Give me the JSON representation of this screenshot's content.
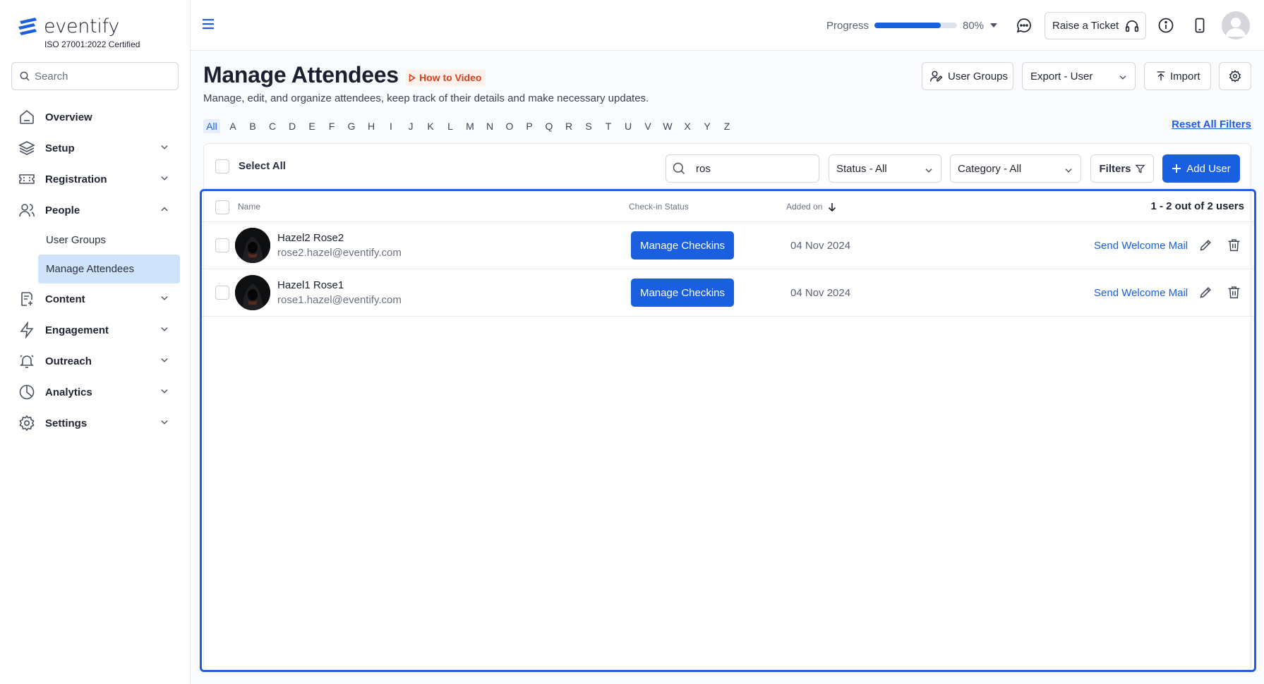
{
  "brand": {
    "name": "eventify",
    "cert": "ISO 27001:2022 Certified",
    "accent": "#1a5fe0"
  },
  "sidebar": {
    "search_placeholder": "Search",
    "items": [
      {
        "label": "Overview",
        "icon": "home-icon"
      },
      {
        "label": "Setup",
        "icon": "layers-icon"
      },
      {
        "label": "Registration",
        "icon": "ticket-icon"
      },
      {
        "label": "People",
        "icon": "users-icon"
      },
      {
        "label": "Content",
        "icon": "document-icon"
      },
      {
        "label": "Engagement",
        "icon": "lightning-icon"
      },
      {
        "label": "Outreach",
        "icon": "bell-icon"
      },
      {
        "label": "Analytics",
        "icon": "pie-chart-icon"
      },
      {
        "label": "Settings",
        "icon": "gear-icon"
      }
    ],
    "people_sub": [
      "User Groups",
      "Manage Attendees"
    ]
  },
  "topbar": {
    "progress_label": "Progress",
    "progress_value": 0.8,
    "progress_text": "80%",
    "ticket_label": "Raise a Ticket"
  },
  "header": {
    "title": "Manage Attendees",
    "how_to": "How to Video",
    "subtitle": "Manage, edit, and organize attendees, keep track of their details and make necessary updates.",
    "btn_user_groups": "User Groups",
    "btn_export": "Export - User",
    "btn_import": "Import"
  },
  "alphabet": [
    "All",
    "A",
    "B",
    "C",
    "D",
    "E",
    "F",
    "G",
    "H",
    "I",
    "J",
    "K",
    "L",
    "M",
    "N",
    "O",
    "P",
    "Q",
    "R",
    "S",
    "T",
    "U",
    "V",
    "W",
    "X",
    "Y",
    "Z"
  ],
  "reset_filters": "Reset All Filters",
  "toolbar": {
    "select_all": "Select All",
    "search_value": "ros",
    "status_select": "Status - All",
    "category_select": "Category - All",
    "filters": "Filters",
    "add_user": "Add User"
  },
  "table": {
    "headers": {
      "name": "Name",
      "checkin": "Check-in Status",
      "added": "Added on"
    },
    "count": "1 - 2 out of 2 users",
    "rows": [
      {
        "name": "Hazel2 Rose2",
        "email": "rose2.hazel@eventify.com",
        "checkin_btn": "Manage Checkins",
        "added": "04 Nov 2024",
        "welcome": "Send Welcome Mail"
      },
      {
        "name": "Hazel1 Rose1",
        "email": "rose1.hazel@eventify.com",
        "checkin_btn": "Manage Checkins",
        "added": "04 Nov 2024",
        "welcome": "Send Welcome Mail"
      }
    ]
  }
}
